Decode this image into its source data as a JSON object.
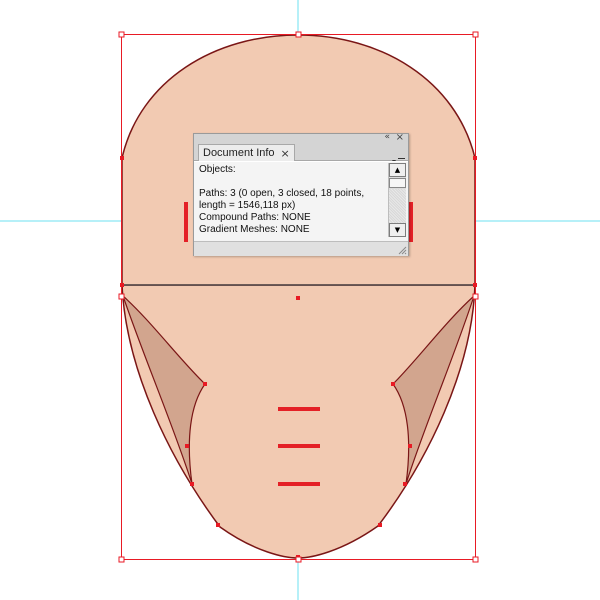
{
  "colors": {
    "skin": "#f2cab2",
    "shadow": "#d2a58e",
    "outline": "#7a1616",
    "selection": "#e81a24",
    "guide": "#6ee2f2",
    "cut_marks": "#e42026"
  },
  "document_info_panel": {
    "tab_label": "Document Info",
    "tab_close_glyph": "×",
    "collapse_glyph": "«",
    "close_glyph": "×",
    "menu_icon": "panel-menu-icon",
    "lines": [
      "Objects:",
      "",
      "Paths: 3 (0 open, 3 closed, 18 points,",
      "length = 1546,118 px)",
      "Compound Paths: NONE",
      "Gradient Meshes: NONE"
    ],
    "scroll_up_glyph": "▲",
    "scroll_down_glyph": "▼"
  }
}
